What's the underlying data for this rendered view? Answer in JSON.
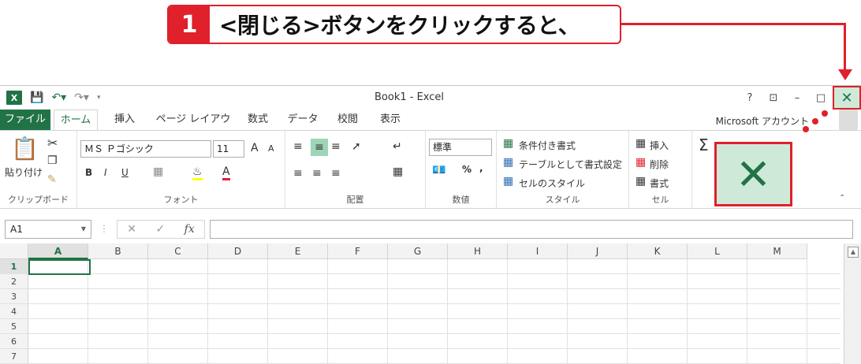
{
  "callout": {
    "step": "1",
    "text": "<閉じる>ボタンをクリックすると、"
  },
  "titlebar": {
    "title": "Book1 - Excel",
    "logo": "X",
    "help": "?",
    "ribbon_display": "⊡",
    "minimize": "–",
    "maximize": "□",
    "close": "✕"
  },
  "qat": {
    "save_icon": "save-icon",
    "undo_icon": "undo-icon",
    "redo_icon": "redo-icon"
  },
  "tabs": [
    {
      "label": "ファイル"
    },
    {
      "label": "ホーム"
    },
    {
      "label": "挿入"
    },
    {
      "label": "ページ レイアウト"
    },
    {
      "label": "数式"
    },
    {
      "label": "データ"
    },
    {
      "label": "校閲"
    },
    {
      "label": "表示"
    }
  ],
  "account": "Microsoft アカウント",
  "ribbon": {
    "clipboard": {
      "label": "クリップボード",
      "paste": "貼り付け"
    },
    "font": {
      "label": "フォント",
      "name": "ＭＳ Ｐゴシック",
      "size": "11",
      "bold": "B",
      "italic": "I",
      "underline": "U",
      "grow": "A",
      "shrink": "A"
    },
    "alignment": {
      "label": "配置"
    },
    "number": {
      "label": "数値",
      "format": "標準",
      "percent": "%",
      "comma": ","
    },
    "styles": {
      "label": "スタイル",
      "conditional": "条件付き書式",
      "table": "テーブルとして書式設定",
      "cell_styles": "セルのスタイル"
    },
    "cells": {
      "label": "セル",
      "insert": "挿入",
      "delete": "削除",
      "format": "書式"
    },
    "editing": {
      "sigma": "Σ"
    }
  },
  "zoomed_close": "✕",
  "formula_bar": {
    "name_box": "A1",
    "cancel": "✕",
    "enter": "✓",
    "fx": "fx",
    "value": ""
  },
  "columns": [
    "A",
    "B",
    "C",
    "D",
    "E",
    "F",
    "G",
    "H",
    "I",
    "J",
    "K",
    "L",
    "M"
  ],
  "rows": [
    "1",
    "2",
    "3",
    "4",
    "5",
    "6",
    "7"
  ],
  "selected_cell": "A1",
  "colors": {
    "excel_green": "#217346",
    "callout_red": "#e0202a",
    "close_bg": "#cfe9d8"
  }
}
